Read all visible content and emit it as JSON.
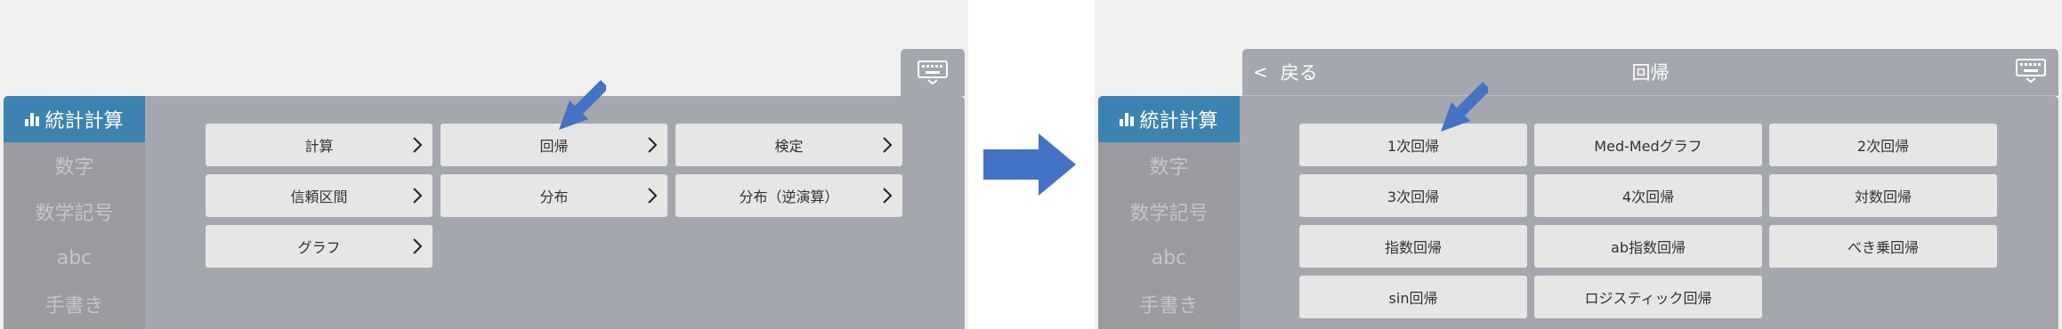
{
  "categories": [
    "統計計算",
    "数字",
    "数学記号",
    "abc",
    "手書き"
  ],
  "before_screen": {
    "buttons": [
      {
        "label": "計算",
        "submenu": true
      },
      {
        "label": "回帰",
        "submenu": true
      },
      {
        "label": "検定",
        "submenu": true
      },
      {
        "label": "信頼区間",
        "submenu": true
      },
      {
        "label": "分布",
        "submenu": true
      },
      {
        "label": "分布（逆演算）",
        "submenu": true
      },
      {
        "label": "グラフ",
        "submenu": true
      }
    ]
  },
  "after_screen": {
    "back_label": "戻る",
    "title": "回帰",
    "buttons": [
      {
        "label": "1次回帰"
      },
      {
        "label": "Med-Medグラフ"
      },
      {
        "label": "2次回帰"
      },
      {
        "label": "3次回帰"
      },
      {
        "label": "4次回帰"
      },
      {
        "label": "対数回帰"
      },
      {
        "label": "指数回帰"
      },
      {
        "label": "ab指数回帰"
      },
      {
        "label": "べき乗回帰"
      },
      {
        "label": "sin回帰"
      },
      {
        "label": "ロジスティック回帰"
      }
    ]
  },
  "icons": {
    "keyboard": "keyboard-icon",
    "stats": "bar-chart-icon",
    "back": "chevron-left-icon",
    "submenu": "chevron-right-icon",
    "callout": "blue-pointer-arrow",
    "transition": "blue-right-arrow"
  },
  "colors": {
    "active_category": "#3d83b2",
    "keyboard_bg": "#a4a7ad",
    "sidebar_bg": "#999ba1",
    "button_bg": "#e6e6e6",
    "callout_arrow": "#4472c4"
  }
}
